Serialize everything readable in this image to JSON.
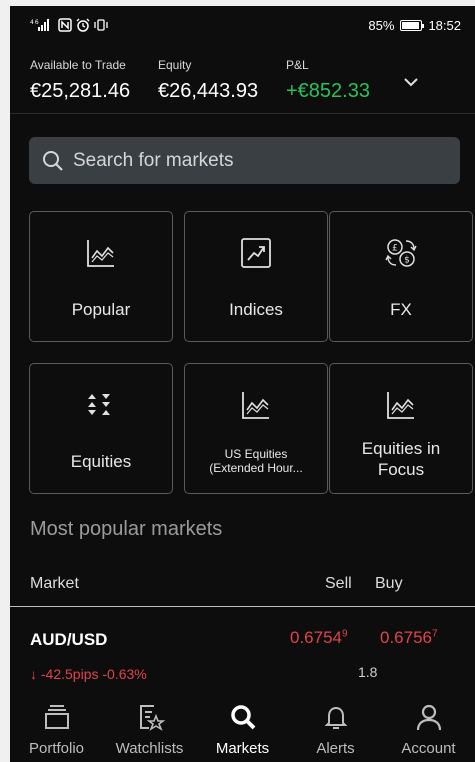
{
  "status_bar": {
    "left_icons": [
      "signal-icon",
      "nfc-icon",
      "alarm-icon",
      "vibrate-icon"
    ],
    "battery_percent": "85%",
    "time": "18:52"
  },
  "account": {
    "available_label": "Available to Trade",
    "available_value": "€25,281.46",
    "equity_label": "Equity",
    "equity_value": "€26,443.93",
    "pnl_label": "P&L",
    "pnl_value": "+€852.33",
    "pnl_color": "#27c25a"
  },
  "search": {
    "placeholder": "Search for markets"
  },
  "categories": [
    {
      "label": "Popular",
      "icon": "chart-area-icon"
    },
    {
      "label": "Indices",
      "icon": "trend-up-icon"
    },
    {
      "label": "FX",
      "icon": "currency-exchange-icon"
    },
    {
      "label": "Equities",
      "icon": "sort-arrows-icon"
    },
    {
      "label": "US Equities (Extended Hour...",
      "line1": "US Equities",
      "line2": "(Extended Hour...",
      "icon": "chart-area-icon"
    },
    {
      "label": "Equities in Focus",
      "line1": "Equities in",
      "line2": "Focus",
      "icon": "chart-area-icon"
    }
  ],
  "markets": {
    "title": "Most popular markets",
    "columns": {
      "market": "Market",
      "sell": "Sell",
      "buy": "Buy"
    },
    "rows": [
      {
        "symbol": "AUD/USD",
        "change": "↓ -42.5pips -0.63%",
        "sell_main": "0.6754",
        "sell_sup": "9",
        "buy_main": "0.6756",
        "buy_sup": "7",
        "spread": "1.8"
      }
    ],
    "negative_color": "#e0434c"
  },
  "tabs": [
    {
      "label": "Portfolio",
      "icon": "portfolio-icon"
    },
    {
      "label": "Watchlists",
      "icon": "watchlist-icon"
    },
    {
      "label": "Markets",
      "icon": "search-icon",
      "active": true
    },
    {
      "label": "Alerts",
      "icon": "bell-icon"
    },
    {
      "label": "Account",
      "icon": "person-icon"
    }
  ]
}
